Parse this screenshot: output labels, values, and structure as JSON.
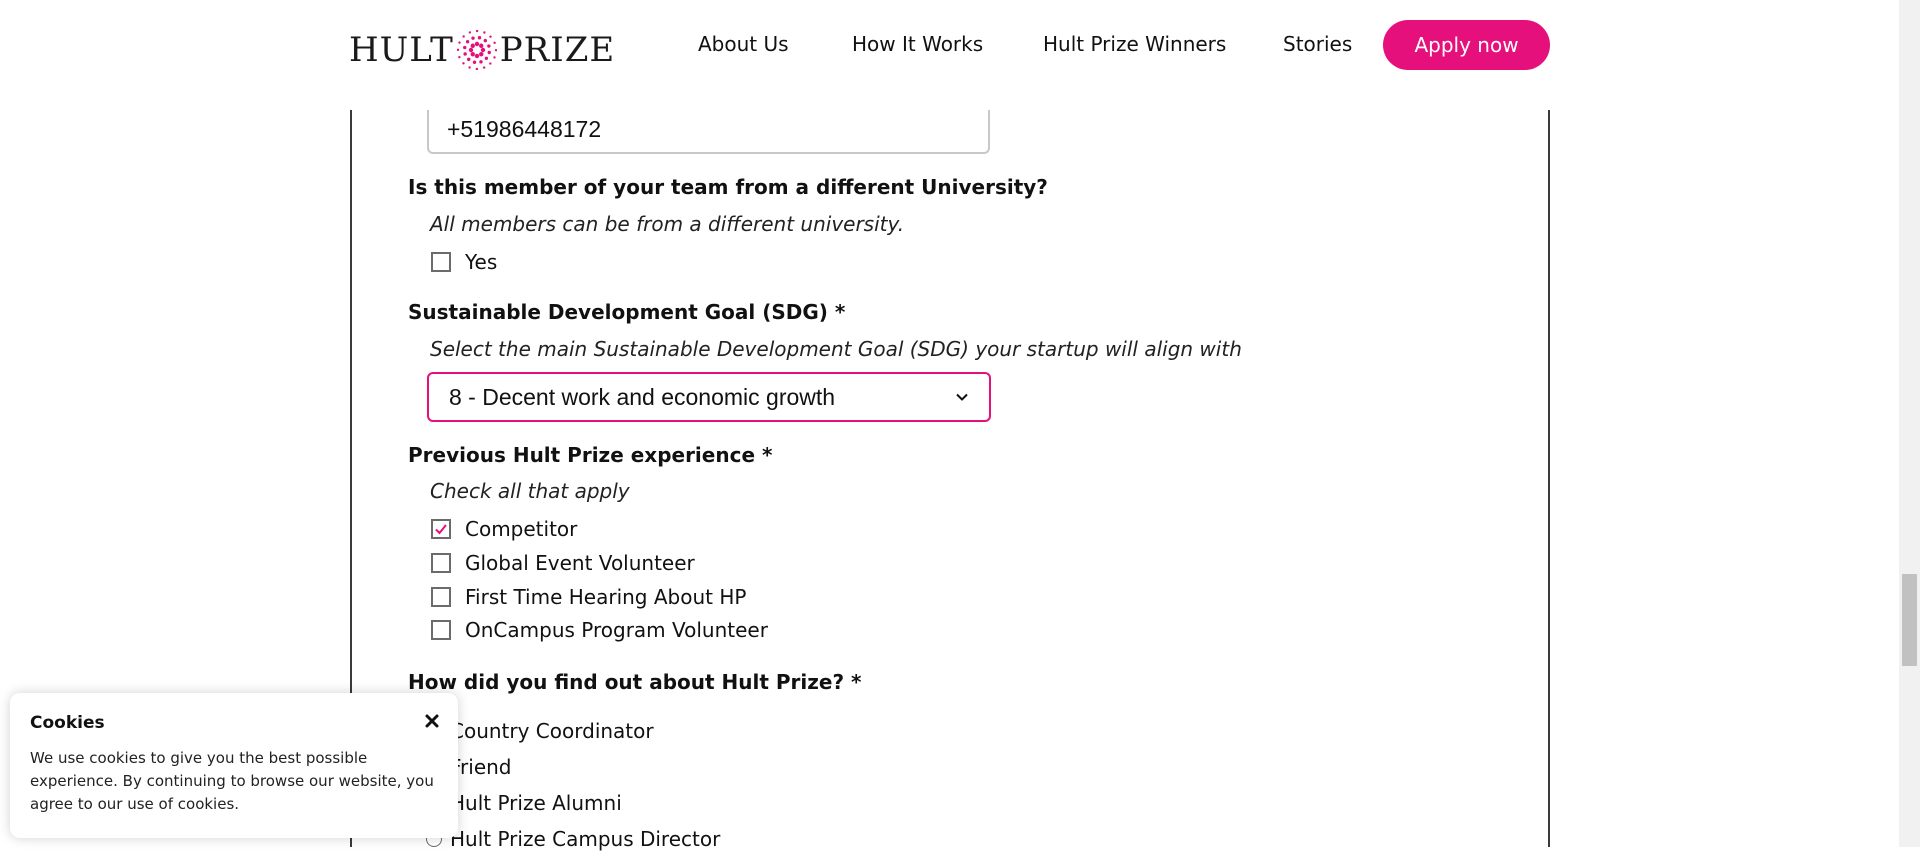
{
  "header": {
    "logo_text_left": "HULT",
    "logo_text_right": "PRIZE",
    "nav": [
      "About Us",
      "How It Works",
      "Hult Prize Winners",
      "Stories"
    ],
    "apply_label": "Apply now",
    "accent_color": "#e5107b"
  },
  "form": {
    "phone_value": "+51986448172",
    "different_university": {
      "question": "Is this member of your team from a different University?",
      "hint": "All members can be from a different university.",
      "option": "Yes",
      "checked": false
    },
    "sdg": {
      "question": "Sustainable Development Goal (SDG) *",
      "hint": "Select the main Sustainable Development Goal (SDG) your startup will align with",
      "selected": "8 - Decent work and economic growth"
    },
    "experience": {
      "question": "Previous Hult Prize experience *",
      "hint": "Check all that apply",
      "options": [
        {
          "label": "Competitor",
          "checked": true
        },
        {
          "label": "Global Event Volunteer",
          "checked": false
        },
        {
          "label": "First Time Hearing About HP",
          "checked": false
        },
        {
          "label": "OnCampus Program Volunteer",
          "checked": false
        }
      ]
    },
    "found_out": {
      "question": "How did you find out about Hult Prize? *",
      "options": [
        "Country Coordinator",
        "Friend",
        "Hult Prize Alumni",
        "Hult Prize Campus Director"
      ]
    }
  },
  "cookie": {
    "title": "Cookies",
    "text": "We use cookies to give you the best possible experience. By continuing to browse our website, you agree to our use of cookies."
  },
  "icons": {
    "logo": "starburst-logo-icon",
    "check": "checkmark-icon",
    "select": "chevron-down-icon",
    "close": "close-icon"
  }
}
